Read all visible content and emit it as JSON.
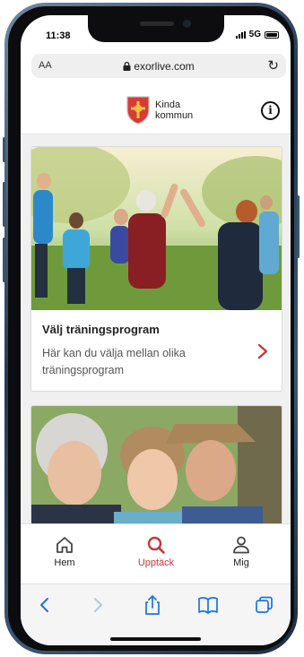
{
  "status": {
    "time": "11:38",
    "network": "5G"
  },
  "browser": {
    "text_size": "AA",
    "url": "exorlive.com"
  },
  "header": {
    "logo_line1": "Kinda",
    "logo_line2": "kommun",
    "info_icon": "info-icon"
  },
  "cards": [
    {
      "title": "Välj träningsprogram",
      "subtitle": "Här kan du välja mellan olika träningsprogram",
      "image": "group-high-five-photo"
    },
    {
      "image": "seniors-smiling-photo"
    }
  ],
  "tabs": [
    {
      "label": "Hem",
      "icon": "home-icon",
      "active": false
    },
    {
      "label": "Upptäck",
      "icon": "search-icon",
      "active": true
    },
    {
      "label": "Mig",
      "icon": "user-icon",
      "active": false
    }
  ],
  "colors": {
    "accent": "#c8373a",
    "safari_blue": "#1a73e8",
    "frame": "#2f4862"
  }
}
